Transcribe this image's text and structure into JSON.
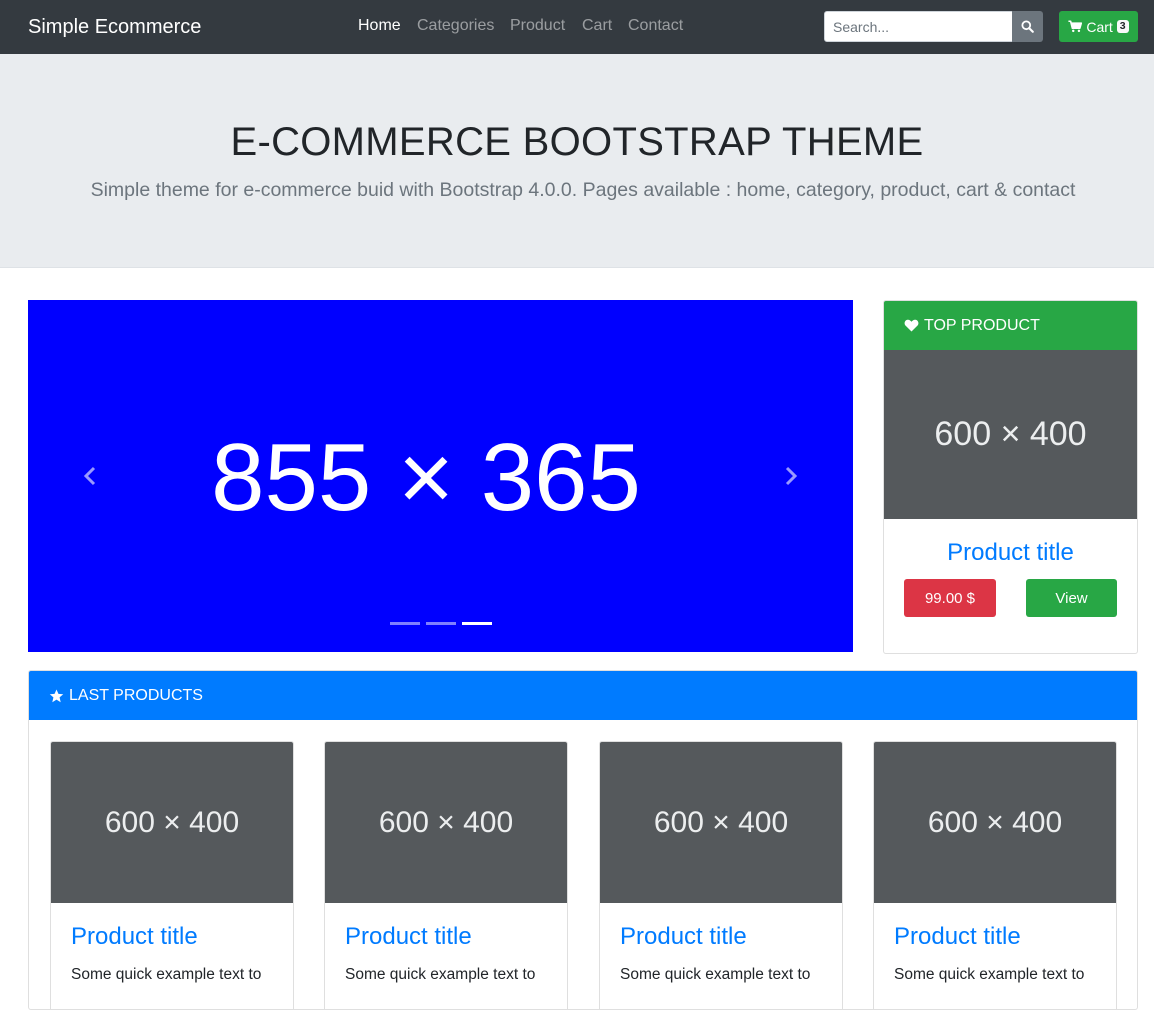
{
  "navbar": {
    "brand": "Simple Ecommerce",
    "links": [
      {
        "label": "Home",
        "active": true
      },
      {
        "label": "Categories",
        "active": false
      },
      {
        "label": "Product",
        "active": false
      },
      {
        "label": "Cart",
        "active": false
      },
      {
        "label": "Contact",
        "active": false
      }
    ],
    "search_placeholder": "Search...",
    "cart_label": "Cart",
    "cart_count": "3",
    "icons": {
      "search": "search-icon",
      "cart": "shopping-cart-icon"
    }
  },
  "jumbotron": {
    "title": "E-COMMERCE BOOTSTRAP THEME",
    "subtitle": "Simple theme for e-commerce buid with Bootstrap 4.0.0. Pages available : home, category, product, cart & contact"
  },
  "carousel": {
    "slide_text": "855 × 365",
    "prev_label": "Previous",
    "next_label": "Next",
    "active_index": 2,
    "slide_count": 3,
    "background": "#0000ff"
  },
  "top_product": {
    "header": "TOP PRODUCT",
    "image_text": "600 × 400",
    "title": "Product title",
    "price": "99.00 $",
    "view_label": "View",
    "header_icon": "heart-icon"
  },
  "last_products": {
    "header": "LAST PRODUCTS",
    "header_icon": "star-icon",
    "items": [
      {
        "image_text": "600 × 400",
        "title": "Product title",
        "text": "Some quick example text to"
      },
      {
        "image_text": "600 × 400",
        "title": "Product title",
        "text": "Some quick example text to"
      },
      {
        "image_text": "600 × 400",
        "title": "Product title",
        "text": "Some quick example text to"
      },
      {
        "image_text": "600 × 400",
        "title": "Product title",
        "text": "Some quick example text to"
      }
    ]
  },
  "colors": {
    "navbar": "#343a40",
    "success": "#28a745",
    "primary": "#007bff",
    "danger": "#dc3545",
    "jumbotron": "#e9ecef"
  }
}
